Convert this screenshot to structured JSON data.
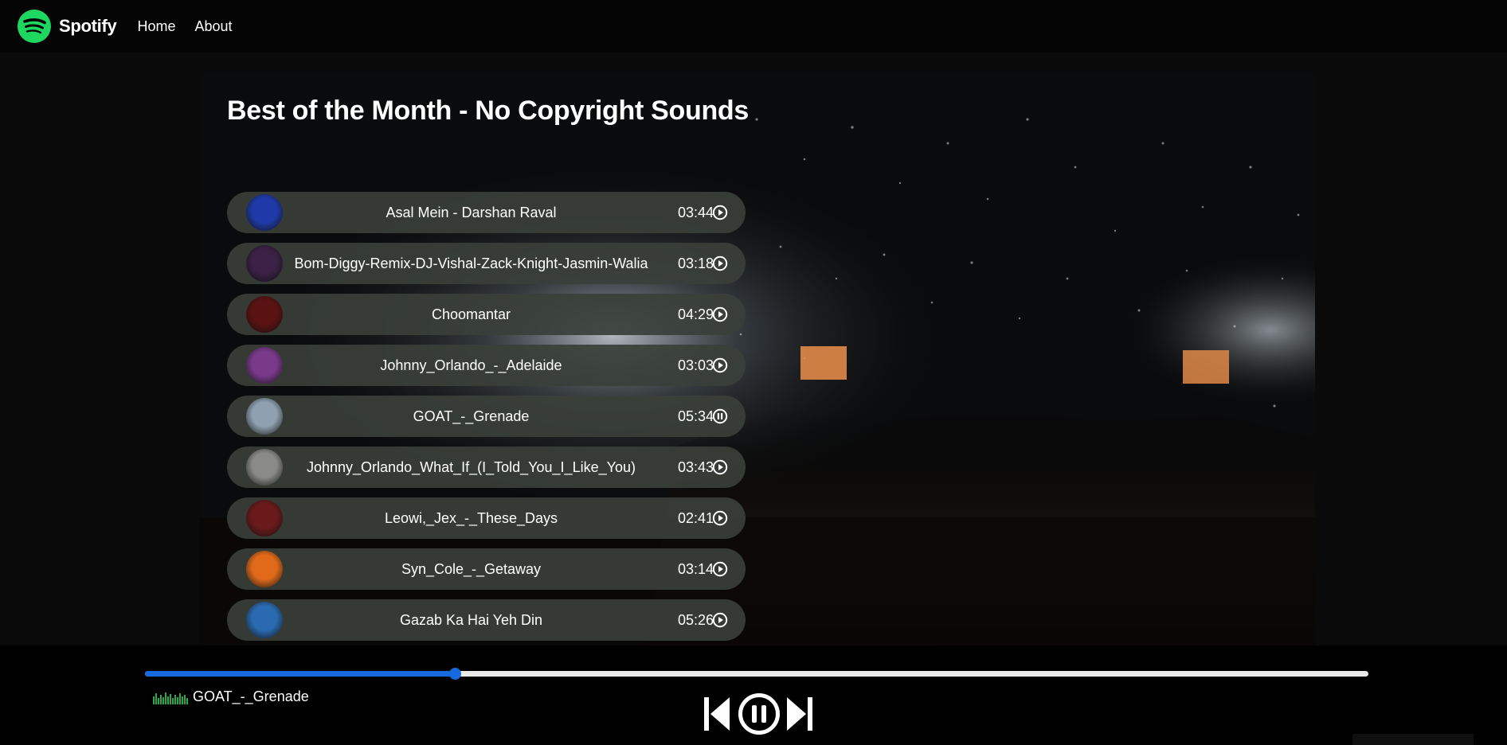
{
  "app": {
    "brand_name": "Spotify",
    "brand_color": "#1ed760",
    "nav": [
      {
        "label": "Home"
      },
      {
        "label": "About"
      }
    ]
  },
  "playlist": {
    "title": "Best of the Month - No Copyright Sounds",
    "songs": [
      {
        "name": "Asal Mein - Darshan Raval",
        "duration": "03:44",
        "icon": "play-circle-icon",
        "cover_color": "#1f3aa8"
      },
      {
        "name": "Bom-Diggy-Remix-DJ-Vishal-Zack-Knight-Jasmin-Walia",
        "duration": "03:18",
        "icon": "play-circle-icon",
        "cover_color": "#3a2145"
      },
      {
        "name": "Choomantar",
        "duration": "04:29",
        "icon": "play-circle-icon",
        "cover_color": "#5a1212"
      },
      {
        "name": "Johnny_Orlando_-_Adelaide",
        "duration": "03:03",
        "icon": "play-circle-icon",
        "cover_color": "#7a3a8a"
      },
      {
        "name": "GOAT_-_Grenade",
        "duration": "05:34",
        "icon": "pause-circle-icon",
        "cover_color": "#8fa0b0"
      },
      {
        "name": "Johnny_Orlando_What_If_(I_Told_You_I_Like_You)",
        "duration": "03:43",
        "icon": "play-circle-icon",
        "cover_color": "#8a8a86"
      },
      {
        "name": "Leowi,_Jex_-_These_Days",
        "duration": "02:41",
        "icon": "play-circle-icon",
        "cover_color": "#6a1a1a"
      },
      {
        "name": "Syn_Cole_-_Getaway",
        "duration": "03:14",
        "icon": "play-circle-icon",
        "cover_color": "#e06a1a"
      },
      {
        "name": "Gazab Ka Hai Yeh Din",
        "duration": "05:26",
        "icon": "play-circle-icon",
        "cover_color": "#2a6ab0"
      }
    ]
  },
  "player": {
    "now_playing": "GOAT_-_Grenade",
    "progress_fraction": 0.253,
    "progress_color": "#1769e0",
    "eq_color": "#2aa84a",
    "controls": [
      {
        "icon": "skip-previous-icon"
      },
      {
        "icon": "pause-circle-icon"
      },
      {
        "icon": "skip-next-icon"
      }
    ]
  }
}
